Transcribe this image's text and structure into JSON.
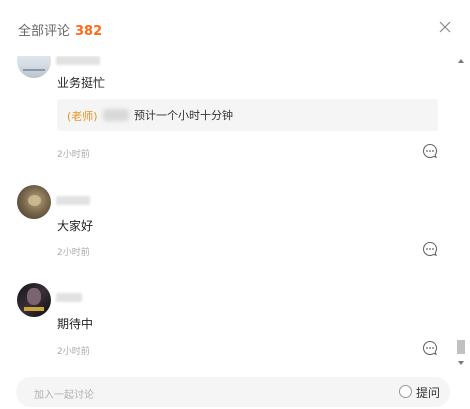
{
  "header": {
    "title": "全部评论",
    "count": "382"
  },
  "comments": [
    {
      "text": "业务挺忙",
      "reply": {
        "tag": "(老师)",
        "text": "预计一个小时十分钟"
      },
      "time": "2小时前"
    },
    {
      "text": "大家好",
      "time": "2小时前"
    },
    {
      "text": "期待中",
      "time": "2小时前"
    }
  ],
  "footer": {
    "placeholder": "加入一起讨论",
    "ask_label": "提问"
  },
  "colors": {
    "accent": "#ff6a1a",
    "teacher_tag": "#e8931c"
  },
  "icons": {
    "close": "close-icon",
    "comment": "comment-bubble-icon"
  }
}
